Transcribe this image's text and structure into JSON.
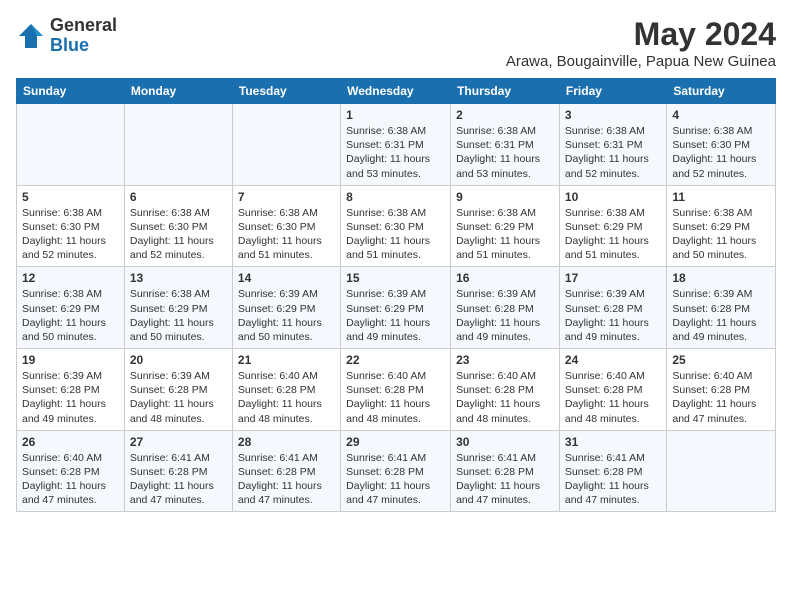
{
  "logo": {
    "general": "General",
    "blue": "Blue"
  },
  "title": {
    "month_year": "May 2024",
    "location": "Arawa, Bougainville, Papua New Guinea"
  },
  "headers": [
    "Sunday",
    "Monday",
    "Tuesday",
    "Wednesday",
    "Thursday",
    "Friday",
    "Saturday"
  ],
  "weeks": [
    [
      {
        "day": "",
        "info": ""
      },
      {
        "day": "",
        "info": ""
      },
      {
        "day": "",
        "info": ""
      },
      {
        "day": "1",
        "info": "Sunrise: 6:38 AM\nSunset: 6:31 PM\nDaylight: 11 hours\nand 53 minutes."
      },
      {
        "day": "2",
        "info": "Sunrise: 6:38 AM\nSunset: 6:31 PM\nDaylight: 11 hours\nand 53 minutes."
      },
      {
        "day": "3",
        "info": "Sunrise: 6:38 AM\nSunset: 6:31 PM\nDaylight: 11 hours\nand 52 minutes."
      },
      {
        "day": "4",
        "info": "Sunrise: 6:38 AM\nSunset: 6:30 PM\nDaylight: 11 hours\nand 52 minutes."
      }
    ],
    [
      {
        "day": "5",
        "info": "Sunrise: 6:38 AM\nSunset: 6:30 PM\nDaylight: 11 hours\nand 52 minutes."
      },
      {
        "day": "6",
        "info": "Sunrise: 6:38 AM\nSunset: 6:30 PM\nDaylight: 11 hours\nand 52 minutes."
      },
      {
        "day": "7",
        "info": "Sunrise: 6:38 AM\nSunset: 6:30 PM\nDaylight: 11 hours\nand 51 minutes."
      },
      {
        "day": "8",
        "info": "Sunrise: 6:38 AM\nSunset: 6:30 PM\nDaylight: 11 hours\nand 51 minutes."
      },
      {
        "day": "9",
        "info": "Sunrise: 6:38 AM\nSunset: 6:29 PM\nDaylight: 11 hours\nand 51 minutes."
      },
      {
        "day": "10",
        "info": "Sunrise: 6:38 AM\nSunset: 6:29 PM\nDaylight: 11 hours\nand 51 minutes."
      },
      {
        "day": "11",
        "info": "Sunrise: 6:38 AM\nSunset: 6:29 PM\nDaylight: 11 hours\nand 50 minutes."
      }
    ],
    [
      {
        "day": "12",
        "info": "Sunrise: 6:38 AM\nSunset: 6:29 PM\nDaylight: 11 hours\nand 50 minutes."
      },
      {
        "day": "13",
        "info": "Sunrise: 6:38 AM\nSunset: 6:29 PM\nDaylight: 11 hours\nand 50 minutes."
      },
      {
        "day": "14",
        "info": "Sunrise: 6:39 AM\nSunset: 6:29 PM\nDaylight: 11 hours\nand 50 minutes."
      },
      {
        "day": "15",
        "info": "Sunrise: 6:39 AM\nSunset: 6:29 PM\nDaylight: 11 hours\nand 49 minutes."
      },
      {
        "day": "16",
        "info": "Sunrise: 6:39 AM\nSunset: 6:28 PM\nDaylight: 11 hours\nand 49 minutes."
      },
      {
        "day": "17",
        "info": "Sunrise: 6:39 AM\nSunset: 6:28 PM\nDaylight: 11 hours\nand 49 minutes."
      },
      {
        "day": "18",
        "info": "Sunrise: 6:39 AM\nSunset: 6:28 PM\nDaylight: 11 hours\nand 49 minutes."
      }
    ],
    [
      {
        "day": "19",
        "info": "Sunrise: 6:39 AM\nSunset: 6:28 PM\nDaylight: 11 hours\nand 49 minutes."
      },
      {
        "day": "20",
        "info": "Sunrise: 6:39 AM\nSunset: 6:28 PM\nDaylight: 11 hours\nand 48 minutes."
      },
      {
        "day": "21",
        "info": "Sunrise: 6:40 AM\nSunset: 6:28 PM\nDaylight: 11 hours\nand 48 minutes."
      },
      {
        "day": "22",
        "info": "Sunrise: 6:40 AM\nSunset: 6:28 PM\nDaylight: 11 hours\nand 48 minutes."
      },
      {
        "day": "23",
        "info": "Sunrise: 6:40 AM\nSunset: 6:28 PM\nDaylight: 11 hours\nand 48 minutes."
      },
      {
        "day": "24",
        "info": "Sunrise: 6:40 AM\nSunset: 6:28 PM\nDaylight: 11 hours\nand 48 minutes."
      },
      {
        "day": "25",
        "info": "Sunrise: 6:40 AM\nSunset: 6:28 PM\nDaylight: 11 hours\nand 47 minutes."
      }
    ],
    [
      {
        "day": "26",
        "info": "Sunrise: 6:40 AM\nSunset: 6:28 PM\nDaylight: 11 hours\nand 47 minutes."
      },
      {
        "day": "27",
        "info": "Sunrise: 6:41 AM\nSunset: 6:28 PM\nDaylight: 11 hours\nand 47 minutes."
      },
      {
        "day": "28",
        "info": "Sunrise: 6:41 AM\nSunset: 6:28 PM\nDaylight: 11 hours\nand 47 minutes."
      },
      {
        "day": "29",
        "info": "Sunrise: 6:41 AM\nSunset: 6:28 PM\nDaylight: 11 hours\nand 47 minutes."
      },
      {
        "day": "30",
        "info": "Sunrise: 6:41 AM\nSunset: 6:28 PM\nDaylight: 11 hours\nand 47 minutes."
      },
      {
        "day": "31",
        "info": "Sunrise: 6:41 AM\nSunset: 6:28 PM\nDaylight: 11 hours\nand 47 minutes."
      },
      {
        "day": "",
        "info": ""
      }
    ]
  ]
}
